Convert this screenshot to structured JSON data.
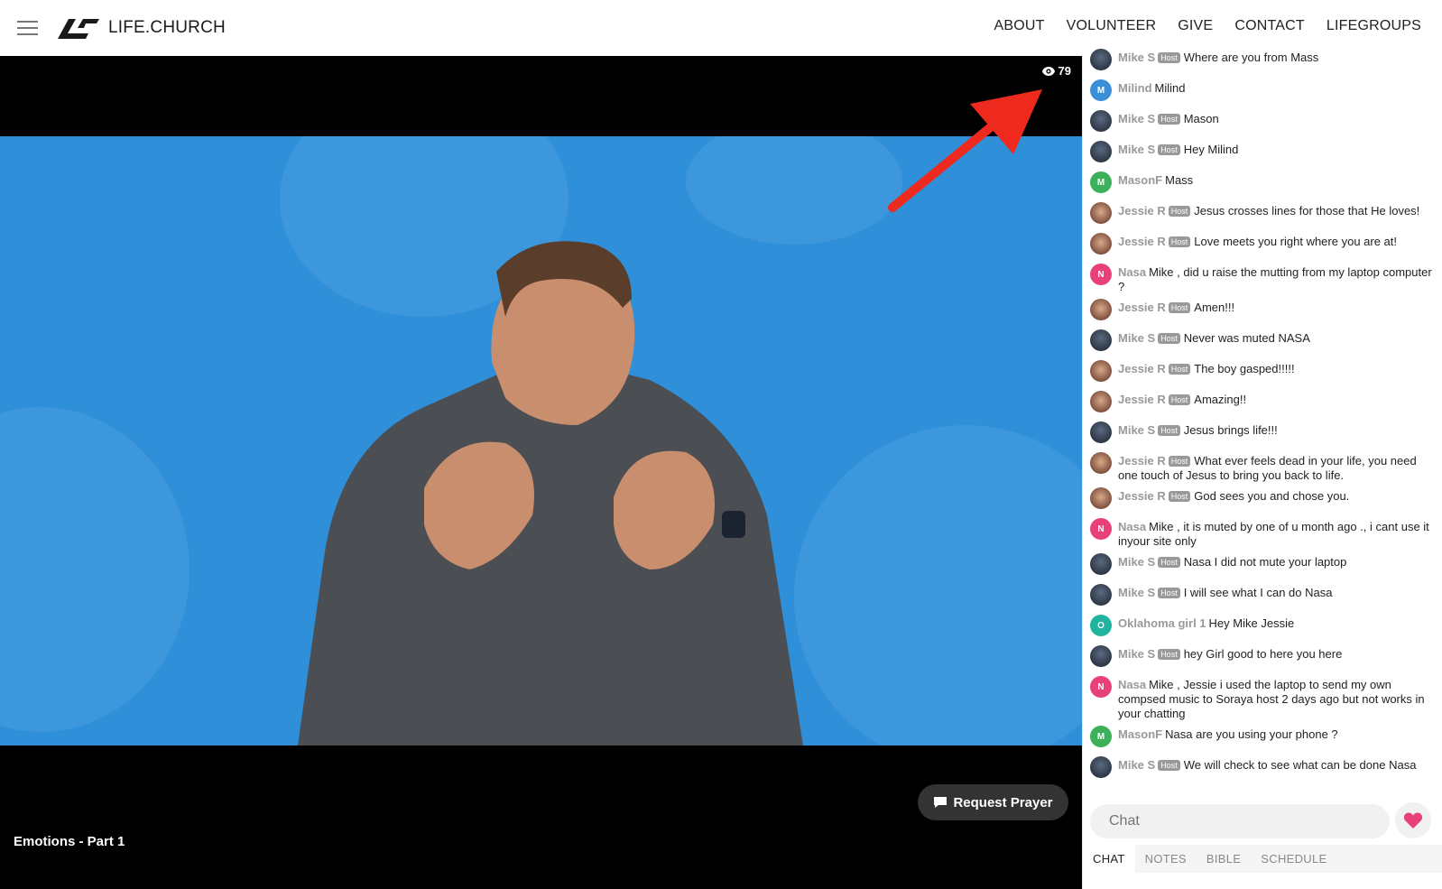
{
  "header": {
    "brand": "LIFE.CHURCH",
    "nav": [
      "ABOUT",
      "VOLUNTEER",
      "GIVE",
      "CONTACT",
      "LIFEGROUPS"
    ]
  },
  "player": {
    "viewer_count": "79",
    "title": "Emotions - Part 1",
    "request_prayer_label": "Request Prayer"
  },
  "chat": {
    "host_badge": "Host",
    "messages": [
      {
        "user": "Mike S",
        "host": true,
        "avatar": "photo-m",
        "text": "Where are you from Mass"
      },
      {
        "user": "Milind",
        "host": false,
        "avatar": "M",
        "color": "#3b8ed8",
        "text": "Milind"
      },
      {
        "user": "Mike S",
        "host": true,
        "avatar": "photo-m",
        "text": "Mason"
      },
      {
        "user": "Mike S",
        "host": true,
        "avatar": "photo-m",
        "text": "Hey Milind"
      },
      {
        "user": "MasonF",
        "host": false,
        "avatar": "M",
        "color": "#3cb05a",
        "text": "Mass"
      },
      {
        "user": "Jessie R",
        "host": true,
        "avatar": "photo-j",
        "text": "Jesus crosses lines for those that He loves!"
      },
      {
        "user": "Jessie R",
        "host": true,
        "avatar": "photo-j",
        "text": "Love meets you right where you are at!"
      },
      {
        "user": "Nasa",
        "host": false,
        "avatar": "N",
        "color": "#e8407a",
        "text": "Mike , did u raise the mutting from my laptop computer ?"
      },
      {
        "user": "Jessie R",
        "host": true,
        "avatar": "photo-j",
        "text": "Amen!!!"
      },
      {
        "user": "Mike S",
        "host": true,
        "avatar": "photo-m",
        "text": "Never was muted NASA"
      },
      {
        "user": "Jessie R",
        "host": true,
        "avatar": "photo-j",
        "text": "The boy gasped!!!!!"
      },
      {
        "user": "Jessie R",
        "host": true,
        "avatar": "photo-j",
        "text": "Amazing!!"
      },
      {
        "user": "Mike S",
        "host": true,
        "avatar": "photo-m",
        "text": "Jesus brings life!!!"
      },
      {
        "user": "Jessie R",
        "host": true,
        "avatar": "photo-j",
        "text": "What ever feels dead in your life, you need one touch of Jesus to bring you back to life."
      },
      {
        "user": "Jessie R",
        "host": true,
        "avatar": "photo-j",
        "text": "God sees you and chose you."
      },
      {
        "user": "Nasa",
        "host": false,
        "avatar": "N",
        "color": "#e8407a",
        "text": "Mike , it is muted by one of u month ago ., i cant use it inyour site only"
      },
      {
        "user": "Mike S",
        "host": true,
        "avatar": "photo-m",
        "text": "Nasa I did not mute your laptop"
      },
      {
        "user": "Mike S",
        "host": true,
        "avatar": "photo-m",
        "text": "I will see what I can do Nasa"
      },
      {
        "user": "Oklahoma girl 1",
        "host": false,
        "avatar": "O",
        "color": "#20b3a0",
        "text": "Hey Mike Jessie"
      },
      {
        "user": "Mike S",
        "host": true,
        "avatar": "photo-m",
        "text": "hey Girl good to here you here"
      },
      {
        "user": "Nasa",
        "host": false,
        "avatar": "N",
        "color": "#e8407a",
        "text": "Mike , Jessie i used the laptop to send my own compsed music to Soraya host 2 days ago but not works in your chatting"
      },
      {
        "user": "MasonF",
        "host": false,
        "avatar": "M",
        "color": "#3cb05a",
        "text": "Nasa are you using your phone ?"
      },
      {
        "user": "Mike S",
        "host": true,
        "avatar": "photo-m",
        "text": "We will check to see what can be done Nasa"
      }
    ],
    "input_placeholder": "Chat"
  },
  "tabs": [
    "CHAT",
    "NOTES",
    "BIBLE",
    "SCHEDULE"
  ],
  "active_tab": "CHAT",
  "colors": {
    "heart": "#e8407a",
    "annotation_arrow": "#ee2a1e",
    "video_bg": "#2f8fd8"
  }
}
